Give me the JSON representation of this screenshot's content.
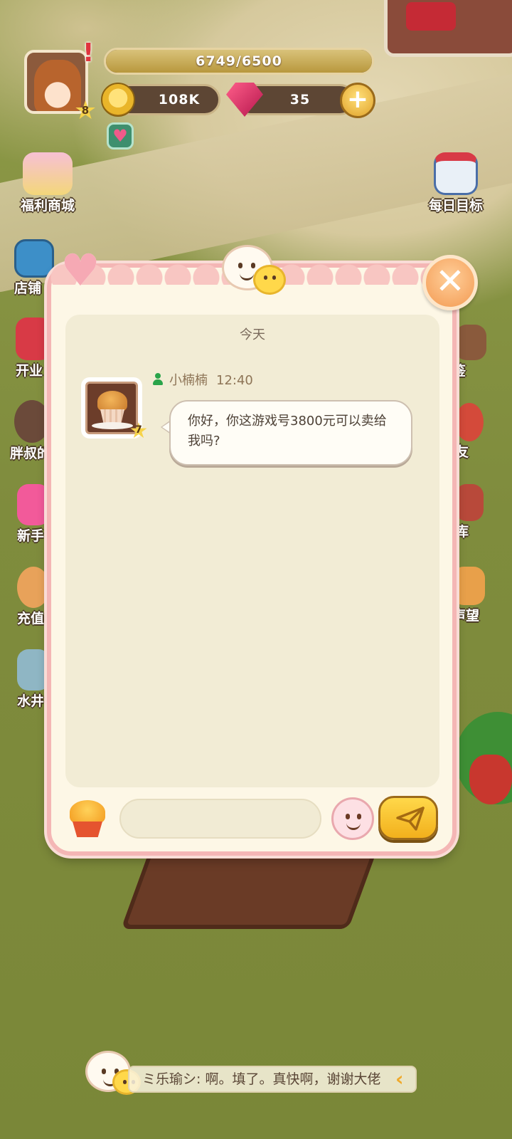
{
  "hud": {
    "player_level": "8",
    "exp_text": "6749/6500",
    "exp_fill": 1.0,
    "coins": "108K",
    "gems": "35"
  },
  "left_menu": [
    {
      "label": "福利商城",
      "icon": "welfare-shop-icon"
    },
    {
      "label": "店铺",
      "icon": "shop-video-icon"
    },
    {
      "label": "开业",
      "icon": "opening-gift-icon"
    },
    {
      "label": "胖叔的",
      "icon": "uncle-character-icon"
    },
    {
      "label": "新手",
      "icon": "newbie-gift-icon"
    },
    {
      "label": "充值",
      "icon": "recharge-girl-icon"
    },
    {
      "label": "水井",
      "icon": "water-well-icon"
    }
  ],
  "right_menu": [
    {
      "label": "每日目标",
      "icon": "calendar-icon"
    },
    {
      "label": "鉴",
      "icon": "guide-book-icon"
    },
    {
      "label": "友",
      "icon": "friends-icon"
    },
    {
      "label": "库",
      "icon": "warehouse-icon"
    },
    {
      "label": "声望",
      "icon": "reputation-icon"
    }
  ],
  "chat": {
    "date_label": "今天",
    "messages": [
      {
        "sender": "小楠楠",
        "time": "12:40",
        "sender_level": "7",
        "text": "你好，你这游戏号3800元可以卖给我吗?"
      }
    ],
    "input_value": "",
    "input_placeholder": ""
  },
  "ticker": {
    "text": "ミ乐瑜シ: 啊。填了。真快啊，谢谢大佬"
  },
  "colors": {
    "dialog_border": "#f4b6b5",
    "dialog_bg": "#fdf7e6",
    "close_button": "#f39a52",
    "send_button": "#f2b01c",
    "sender_icon": "#2aa44a"
  }
}
